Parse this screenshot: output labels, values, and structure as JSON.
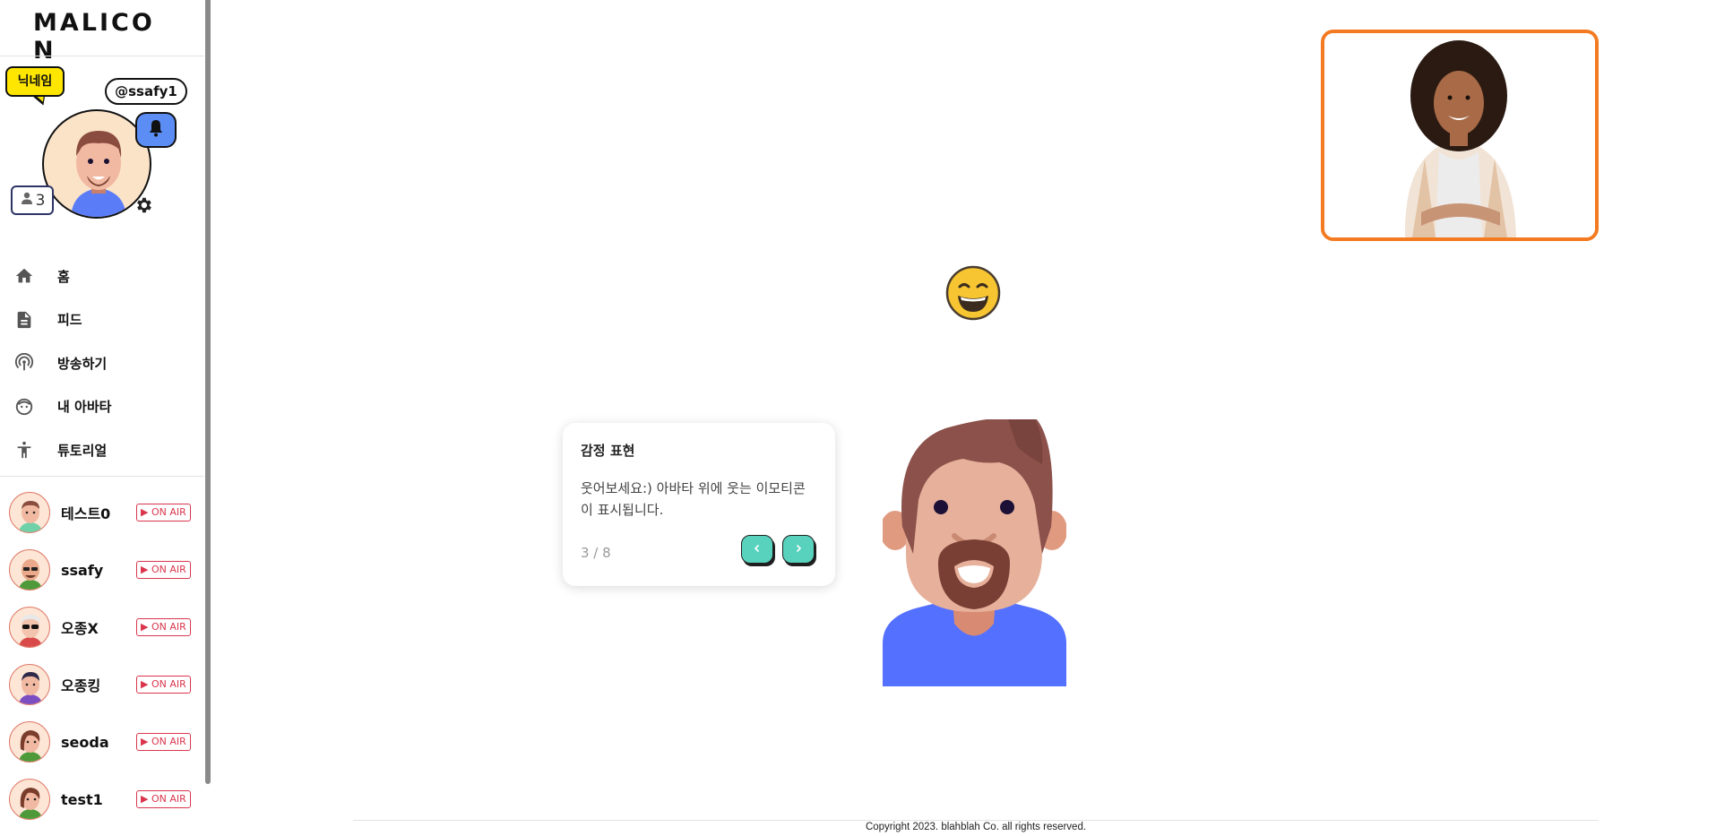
{
  "app": {
    "logo_letters": [
      "M",
      "A",
      "L",
      "I",
      "C",
      "O",
      "N"
    ],
    "logo_colors": [
      "#5b6cf0",
      "#f5a623",
      "#e02c5a",
      "#111111",
      "#d12f2f",
      "#2a7de1",
      "#f5a623"
    ]
  },
  "profile": {
    "nickname_badge": "닉네임",
    "handle": "@ssafy1",
    "followers": "3",
    "bell_icon": "bell-icon",
    "settings_icon": "gear-icon"
  },
  "nav": {
    "items": [
      {
        "label": "홈",
        "icon": "home-icon"
      },
      {
        "label": "피드",
        "icon": "document-icon"
      },
      {
        "label": "방송하기",
        "icon": "broadcast-icon"
      },
      {
        "label": "내 아바타",
        "icon": "face-icon"
      },
      {
        "label": "튜토리얼",
        "icon": "accessibility-icon"
      }
    ]
  },
  "live": {
    "onair_label": "▶ ON AIR",
    "users": [
      {
        "name": "테스트0"
      },
      {
        "name": "ssafy"
      },
      {
        "name": "오종X"
      },
      {
        "name": "오종킹"
      },
      {
        "name": "seoda"
      },
      {
        "name": "test1"
      }
    ]
  },
  "tutorial": {
    "title": "감정 표현",
    "body": "웃어보세요:) 아바타 위에 웃는 이모티콘이 표시됩니다.",
    "step": "3 / 8",
    "prev_icon": "chevron-left-icon",
    "next_icon": "chevron-right-icon"
  },
  "footer": {
    "copyright": "Copyright 2023. blahblah Co. all rights reserved."
  },
  "colors": {
    "accent": "#f37a21",
    "button": "#58d2bd",
    "onair": "#d9364d",
    "nickname": "#ffe600",
    "bell": "#5b8df5"
  }
}
